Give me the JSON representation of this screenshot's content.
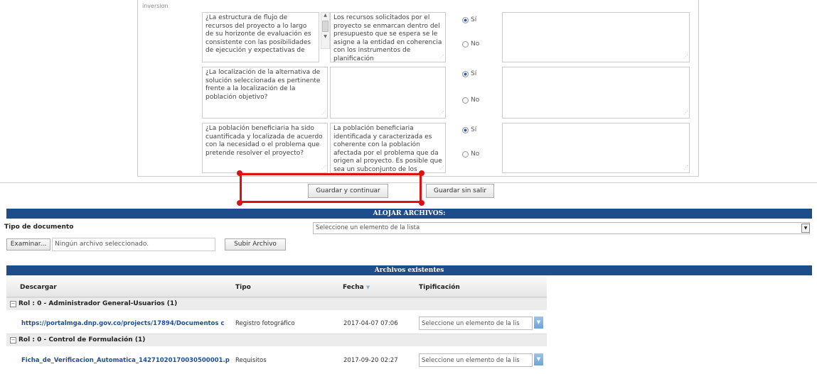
{
  "section_label": "inversion",
  "questions": [
    {
      "question": "¿La estructura de flujo de recursos del proyecto a lo largo de su horizonte de evaluación es consistente con las posibilidades de ejecución y expectativas de",
      "criterion": "Los recursos solicitados por el proyecto se enmarcan dentro del presupuesto que se espera se le asigne a la entidad en coherencia con los instrumentos de planificación",
      "si": "Sí",
      "no": "No",
      "selected": "Sí"
    },
    {
      "question": "¿La localización de la alternativa de solución seleccionada es pertinente frente a la localización de la población objetivo?",
      "criterion": "",
      "si": "Sí",
      "no": "No",
      "selected": "Sí"
    },
    {
      "question": "¿La población beneficiaria ha sido cuantificada y localizada de acuerdo con la necesidad o el problema que pretende resolver el proyecto?",
      "criterion": "La población beneficiaria identificada y caracterizada es coherente con la población afectada por el problema que da origen al proyecto. Es posible que sea un subconjunto de los afectados.",
      "si": "Sí",
      "no": "No",
      "selected": "Sí"
    }
  ],
  "buttons": {
    "save_continue": "Guardar y continuar",
    "save_stay": "Guardar sin salir"
  },
  "upload": {
    "bar_title": "ALOJAR ARCHIVOS:",
    "doc_type_label": "Tipo de documento",
    "doc_type_value": "Seleccione un elemento de la lista",
    "browse": "Examinar...",
    "no_file": "Ningún archivo seleccionado.",
    "upload_btn": "Subir Archivo"
  },
  "files": {
    "bar_title": "Archivos existentes",
    "columns": [
      "Descargar",
      "Tipo",
      "Fecha",
      "Tipificación"
    ],
    "groups": [
      {
        "label": "Rol : 0 - Administrador General-Usuarios (1)",
        "row": {
          "link": "https://portalmga.dnp.gov.co/projects/17894/Documentos c",
          "tipo": "Registro fotográfico",
          "fecha": "2017-04-07 07:06",
          "tipificacion": "Seleccione un elemento de la lis"
        }
      },
      {
        "label": "Rol : 0 - Control de Formulación (1)",
        "row": {
          "link": "Ficha_de_Verificacion_Automatica_14271020170030500001.p",
          "tipo": "Requisitos",
          "fecha": "2017-09-20 02:27",
          "tipificacion": "Seleccione un elemento de la lis"
        }
      }
    ]
  },
  "colors": {
    "header_bar": "#1e4d8c",
    "highlight": "#e01010",
    "link": "#1f4e97"
  }
}
